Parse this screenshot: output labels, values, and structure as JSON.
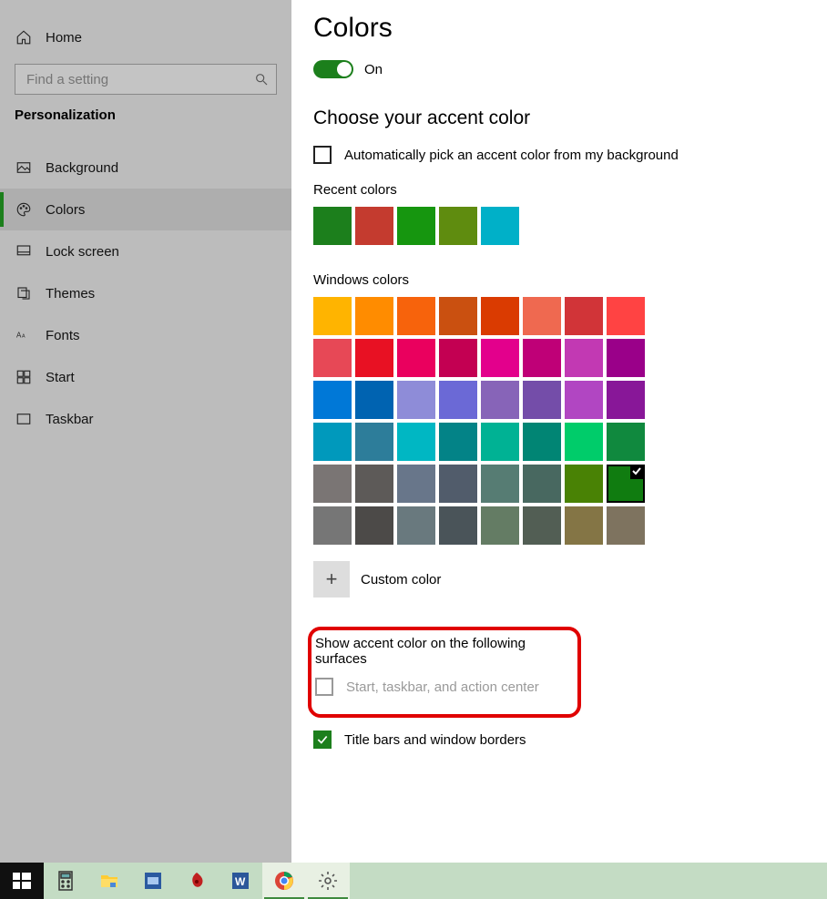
{
  "sidebar": {
    "home": "Home",
    "search_placeholder": "Find a setting",
    "category": "Personalization",
    "items": [
      {
        "label": "Background"
      },
      {
        "label": "Colors"
      },
      {
        "label": "Lock screen"
      },
      {
        "label": "Themes"
      },
      {
        "label": "Fonts"
      },
      {
        "label": "Start"
      },
      {
        "label": "Taskbar"
      }
    ]
  },
  "main": {
    "title": "Colors",
    "toggle_state": "On",
    "accent_heading": "Choose your accent color",
    "auto_pick_label": "Automatically pick an accent color from my background",
    "recent_heading": "Recent colors",
    "recent_colors": [
      "#1c7f1c",
      "#c43b2f",
      "#16960f",
      "#5f8c0f",
      "#00b0c8"
    ],
    "windows_heading": "Windows colors",
    "windows_colors": [
      "#ffb400",
      "#ff8c00",
      "#f7630c",
      "#ca5010",
      "#da3b01",
      "#ef6950",
      "#d13438",
      "#ff4343",
      "#e74856",
      "#e81123",
      "#ea005e",
      "#c30052",
      "#e3008c",
      "#bf0077",
      "#c239b3",
      "#9a0089",
      "#0078d7",
      "#0063b1",
      "#8e8cd8",
      "#6b69d6",
      "#8764b8",
      "#744da9",
      "#b146c2",
      "#881798",
      "#0099bc",
      "#2d7d9a",
      "#00b7c3",
      "#038387",
      "#00b294",
      "#018574",
      "#00cc6a",
      "#10893e",
      "#7a7574",
      "#5d5a58",
      "#68768a",
      "#515c6b",
      "#567c73",
      "#486860",
      "#498205",
      "#107c10",
      "#767676",
      "#4c4a48",
      "#69797e",
      "#4a5459",
      "#647c64",
      "#525e54",
      "#847545",
      "#7e735f"
    ],
    "selected_index": 39,
    "custom_label": "Custom color",
    "surfaces_heading": "Show accent color on the following surfaces",
    "surface_start_label": "Start, taskbar, and action center",
    "surface_title_label": "Title bars and window borders"
  }
}
